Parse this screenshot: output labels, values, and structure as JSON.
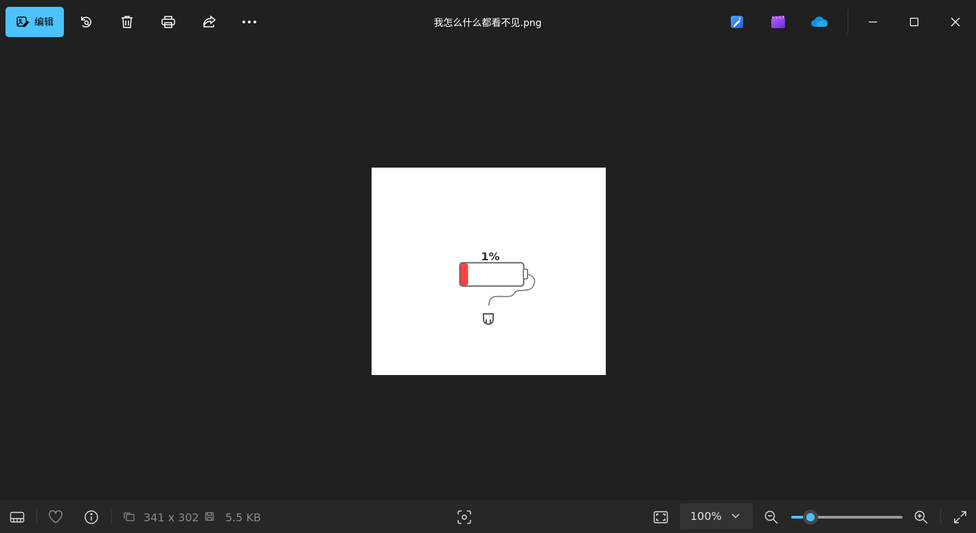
{
  "app": {
    "filename": "我怎么什么都看不见.png",
    "accent_color": "#4cc2ff"
  },
  "toolbar": {
    "edit_label": "编辑",
    "icons": [
      "rotate-icon",
      "delete-icon",
      "print-icon",
      "share-icon",
      "more-icon"
    ],
    "right_icons": [
      "designer-app-icon",
      "clipchamp-app-icon",
      "onedrive-icon"
    ]
  },
  "window_controls": [
    "minimize",
    "maximize",
    "close"
  ],
  "image": {
    "battery_text": "1%",
    "battery_fill_color": "#ff4040"
  },
  "status": {
    "dimensions": "341 x 302",
    "file_size": "5.5 KB",
    "zoom_label": "100%",
    "zoom_level_fraction": 0.17
  }
}
